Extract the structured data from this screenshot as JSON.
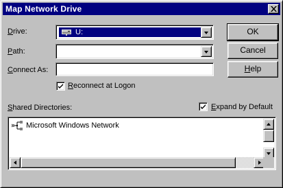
{
  "window": {
    "title": "Map Network Drive"
  },
  "form": {
    "drive_label_mnemonic": "D",
    "drive_label_rest": "rive:",
    "drive_value": "U:",
    "path_label_mnemonic": "P",
    "path_label_rest": "ath:",
    "path_value": "",
    "connect_as_label_pre": "",
    "connect_as_label_mnemonic": "C",
    "connect_as_label_rest": "onnect As:",
    "connect_as_value": "",
    "reconnect_label_mnemonic": "R",
    "reconnect_label_rest": "econnect at Logon",
    "reconnect_checked": true
  },
  "buttons": {
    "ok": "OK",
    "cancel": "Cancel",
    "help_mnemonic": "H",
    "help_rest": "elp"
  },
  "shared": {
    "label_mnemonic": "S",
    "label_rest": "hared Directories:",
    "expand_label_mnemonic": "E",
    "expand_label_rest": "xpand by Default",
    "expand_checked": true,
    "items": [
      "Microsoft Windows Network"
    ]
  },
  "icons": {
    "close": "close-icon",
    "drive": "network-drive-icon",
    "network": "network-icon",
    "check": "checkmark-icon"
  }
}
